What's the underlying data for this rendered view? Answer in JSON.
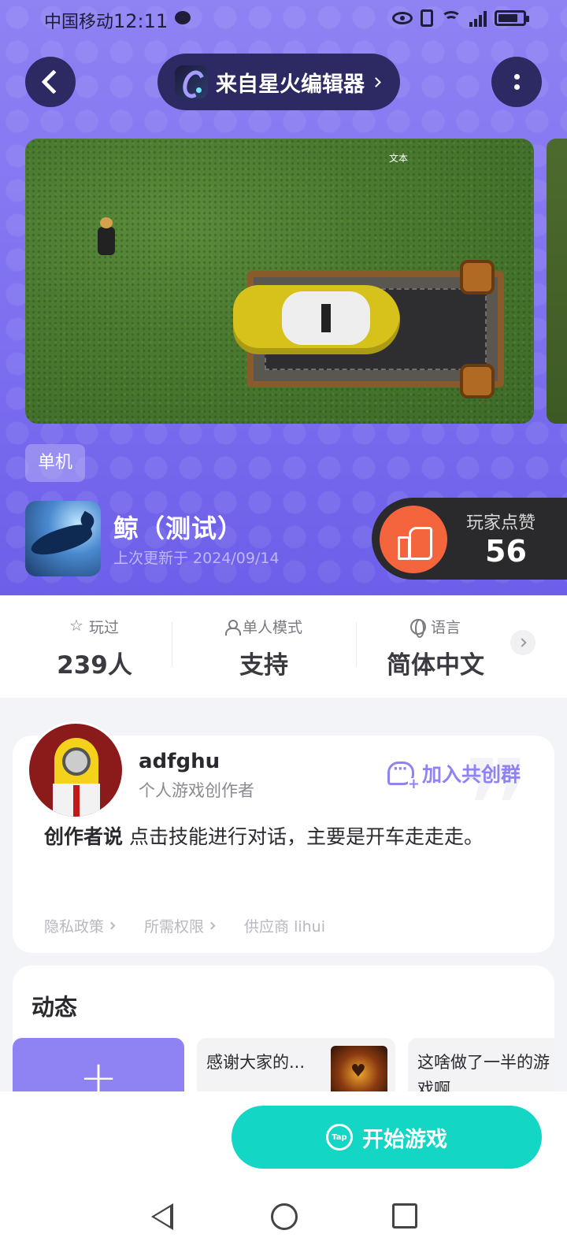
{
  "status_bar": {
    "carrier": "中国移动",
    "time": "12:11"
  },
  "header": {
    "source_label": "来自星火编辑器"
  },
  "screenshot": {
    "overlay_text": "文本"
  },
  "tag": "单机",
  "game": {
    "title": "鲸（测试）",
    "updated": "上次更新于 2024/09/14"
  },
  "likes": {
    "label": "玩家点赞",
    "count": "56"
  },
  "stats": [
    {
      "icon": "star-icon",
      "label": "玩过",
      "value": "239人"
    },
    {
      "icon": "person-icon",
      "label": "单人模式",
      "value": "支持"
    },
    {
      "icon": "globe-icon",
      "label": "语言",
      "value": "简体中文"
    }
  ],
  "creator": {
    "name": "adfghu",
    "role": "个人游戏创作者",
    "join_label": "加入共创群",
    "says_label": "创作者说",
    "says_text": "点击技能进行对话，主要是开车走走走。",
    "links": {
      "privacy": "隐私政策",
      "permissions": "所需权限",
      "supplier": "供应商 lihui"
    }
  },
  "dynamic": {
    "title": "动态",
    "add_label": "+",
    "posts": [
      {
        "text": "感谢大家的..."
      },
      {
        "text": "这啥做了一半的游戏啊"
      }
    ]
  },
  "bottom": {
    "start_label": "开始游戏",
    "tap_logo": "Tap"
  },
  "colors": {
    "hero": "#8f82f3",
    "accent": "#13d6c4",
    "like": "#f5653d"
  }
}
